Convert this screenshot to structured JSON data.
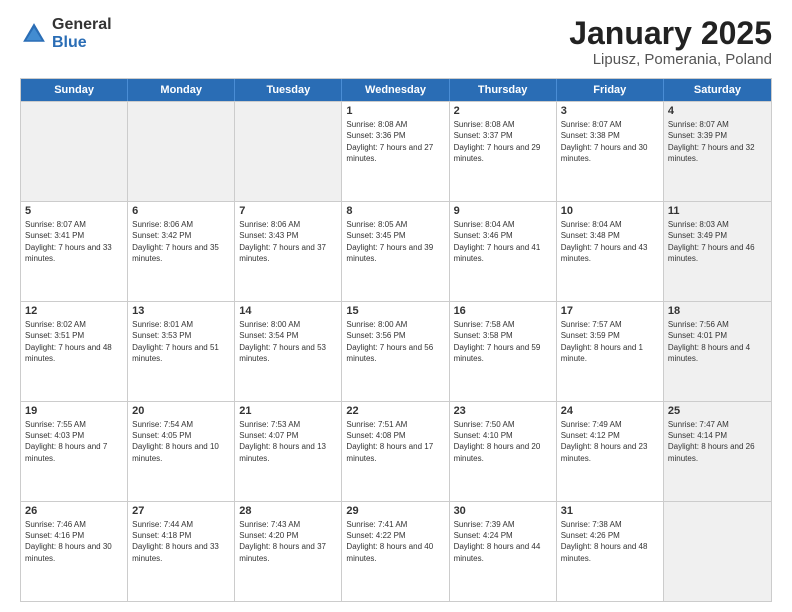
{
  "header": {
    "logo_general": "General",
    "logo_blue": "Blue",
    "title": "January 2025",
    "subtitle": "Lipusz, Pomerania, Poland"
  },
  "weekdays": [
    "Sunday",
    "Monday",
    "Tuesday",
    "Wednesday",
    "Thursday",
    "Friday",
    "Saturday"
  ],
  "weeks": [
    [
      {
        "day": "",
        "text": "",
        "shaded": true
      },
      {
        "day": "",
        "text": "",
        "shaded": true
      },
      {
        "day": "",
        "text": "",
        "shaded": true
      },
      {
        "day": "1",
        "text": "Sunrise: 8:08 AM\nSunset: 3:36 PM\nDaylight: 7 hours and 27 minutes."
      },
      {
        "day": "2",
        "text": "Sunrise: 8:08 AM\nSunset: 3:37 PM\nDaylight: 7 hours and 29 minutes."
      },
      {
        "day": "3",
        "text": "Sunrise: 8:07 AM\nSunset: 3:38 PM\nDaylight: 7 hours and 30 minutes."
      },
      {
        "day": "4",
        "text": "Sunrise: 8:07 AM\nSunset: 3:39 PM\nDaylight: 7 hours and 32 minutes.",
        "shaded": true
      }
    ],
    [
      {
        "day": "5",
        "text": "Sunrise: 8:07 AM\nSunset: 3:41 PM\nDaylight: 7 hours and 33 minutes."
      },
      {
        "day": "6",
        "text": "Sunrise: 8:06 AM\nSunset: 3:42 PM\nDaylight: 7 hours and 35 minutes."
      },
      {
        "day": "7",
        "text": "Sunrise: 8:06 AM\nSunset: 3:43 PM\nDaylight: 7 hours and 37 minutes."
      },
      {
        "day": "8",
        "text": "Sunrise: 8:05 AM\nSunset: 3:45 PM\nDaylight: 7 hours and 39 minutes."
      },
      {
        "day": "9",
        "text": "Sunrise: 8:04 AM\nSunset: 3:46 PM\nDaylight: 7 hours and 41 minutes."
      },
      {
        "day": "10",
        "text": "Sunrise: 8:04 AM\nSunset: 3:48 PM\nDaylight: 7 hours and 43 minutes."
      },
      {
        "day": "11",
        "text": "Sunrise: 8:03 AM\nSunset: 3:49 PM\nDaylight: 7 hours and 46 minutes.",
        "shaded": true
      }
    ],
    [
      {
        "day": "12",
        "text": "Sunrise: 8:02 AM\nSunset: 3:51 PM\nDaylight: 7 hours and 48 minutes."
      },
      {
        "day": "13",
        "text": "Sunrise: 8:01 AM\nSunset: 3:53 PM\nDaylight: 7 hours and 51 minutes."
      },
      {
        "day": "14",
        "text": "Sunrise: 8:00 AM\nSunset: 3:54 PM\nDaylight: 7 hours and 53 minutes."
      },
      {
        "day": "15",
        "text": "Sunrise: 8:00 AM\nSunset: 3:56 PM\nDaylight: 7 hours and 56 minutes."
      },
      {
        "day": "16",
        "text": "Sunrise: 7:58 AM\nSunset: 3:58 PM\nDaylight: 7 hours and 59 minutes."
      },
      {
        "day": "17",
        "text": "Sunrise: 7:57 AM\nSunset: 3:59 PM\nDaylight: 8 hours and 1 minute."
      },
      {
        "day": "18",
        "text": "Sunrise: 7:56 AM\nSunset: 4:01 PM\nDaylight: 8 hours and 4 minutes.",
        "shaded": true
      }
    ],
    [
      {
        "day": "19",
        "text": "Sunrise: 7:55 AM\nSunset: 4:03 PM\nDaylight: 8 hours and 7 minutes."
      },
      {
        "day": "20",
        "text": "Sunrise: 7:54 AM\nSunset: 4:05 PM\nDaylight: 8 hours and 10 minutes."
      },
      {
        "day": "21",
        "text": "Sunrise: 7:53 AM\nSunset: 4:07 PM\nDaylight: 8 hours and 13 minutes."
      },
      {
        "day": "22",
        "text": "Sunrise: 7:51 AM\nSunset: 4:08 PM\nDaylight: 8 hours and 17 minutes."
      },
      {
        "day": "23",
        "text": "Sunrise: 7:50 AM\nSunset: 4:10 PM\nDaylight: 8 hours and 20 minutes."
      },
      {
        "day": "24",
        "text": "Sunrise: 7:49 AM\nSunset: 4:12 PM\nDaylight: 8 hours and 23 minutes."
      },
      {
        "day": "25",
        "text": "Sunrise: 7:47 AM\nSunset: 4:14 PM\nDaylight: 8 hours and 26 minutes.",
        "shaded": true
      }
    ],
    [
      {
        "day": "26",
        "text": "Sunrise: 7:46 AM\nSunset: 4:16 PM\nDaylight: 8 hours and 30 minutes."
      },
      {
        "day": "27",
        "text": "Sunrise: 7:44 AM\nSunset: 4:18 PM\nDaylight: 8 hours and 33 minutes."
      },
      {
        "day": "28",
        "text": "Sunrise: 7:43 AM\nSunset: 4:20 PM\nDaylight: 8 hours and 37 minutes."
      },
      {
        "day": "29",
        "text": "Sunrise: 7:41 AM\nSunset: 4:22 PM\nDaylight: 8 hours and 40 minutes."
      },
      {
        "day": "30",
        "text": "Sunrise: 7:39 AM\nSunset: 4:24 PM\nDaylight: 8 hours and 44 minutes."
      },
      {
        "day": "31",
        "text": "Sunrise: 7:38 AM\nSunset: 4:26 PM\nDaylight: 8 hours and 48 minutes."
      },
      {
        "day": "",
        "text": "",
        "shaded": true
      }
    ]
  ]
}
